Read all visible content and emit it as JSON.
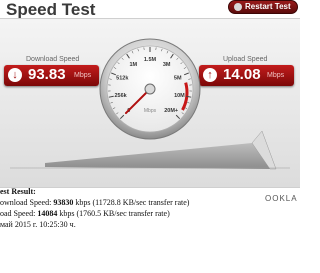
{
  "header": {
    "title": "Speed Test",
    "restart_label": "Restart Test"
  },
  "download": {
    "label": "Download Speed",
    "value": "93.83",
    "unit": "Mbps"
  },
  "upload": {
    "label": "Upload Speed",
    "value": "14.08",
    "unit": "Mbps"
  },
  "gauge": {
    "unit": "Mbps",
    "ticks": [
      "0",
      "256k",
      "512k",
      "1M",
      "1.5M",
      "3M",
      "5M",
      "10M",
      "20M+"
    ],
    "needle_label": "0"
  },
  "brand": "OOKLA",
  "results": {
    "heading": "est Result:",
    "download_prefix": "ownload Speed: ",
    "download_kbps": "93830",
    "download_suffix": " kbps (11728.8 KB/sec transfer rate)",
    "upload_prefix": "oad Speed: ",
    "upload_kbps": "14084",
    "upload_suffix": " kbps (1760.5 KB/sec transfer rate)",
    "date": " май 2015 г. 10:25:30 ч."
  },
  "colors": {
    "accent": "#a01010",
    "panel": "#e6e6e6"
  }
}
